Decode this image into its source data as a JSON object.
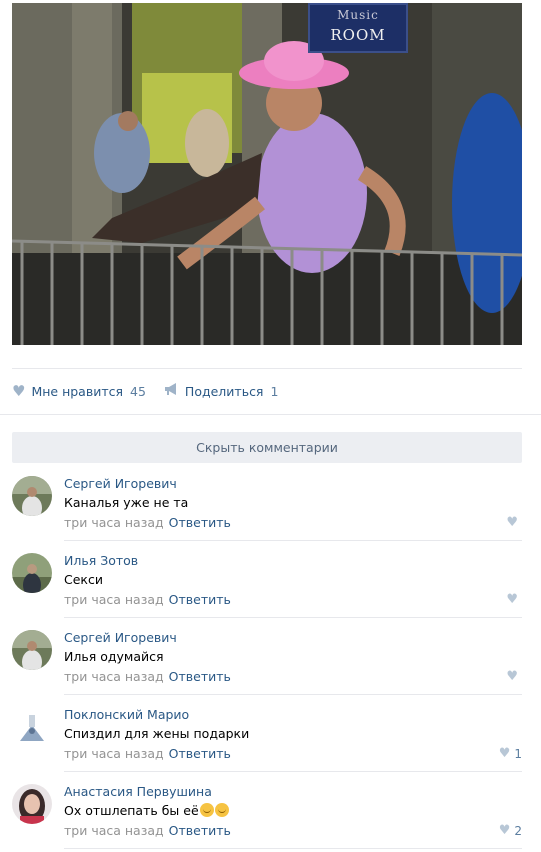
{
  "photo": {
    "sign_line1": "Music",
    "sign_line2": "ROOM"
  },
  "actions": {
    "like_label": "Мне нравится",
    "like_count": "45",
    "share_label": "Поделиться",
    "share_count": "1"
  },
  "hide_comments_label": "Скрыть комментарии",
  "comments": [
    {
      "author": "Сергей Игоревич",
      "text": "Каналья уже не та",
      "time": "три часа назад",
      "reply": "Ответить",
      "likes": ""
    },
    {
      "author": "Илья Зотов",
      "text": "Секси",
      "time": "три часа назад",
      "reply": "Ответить",
      "likes": ""
    },
    {
      "author": "Сергей Игоревич",
      "text": "Илья одумайся",
      "time": "три часа назад",
      "reply": "Ответить",
      "likes": ""
    },
    {
      "author": "Поклонский Марио",
      "text": "Спиздил для жены подарки",
      "time": "три часа назад",
      "reply": "Ответить",
      "likes": "1"
    },
    {
      "author": "Анастасия Первушина",
      "text": "Ох отшлепать бы её",
      "time": "три часа назад",
      "reply": "Ответить",
      "likes": "2"
    }
  ],
  "colors": {
    "link": "#2a5885",
    "meta": "#939393",
    "button_bg": "#eceef2",
    "divider": "#e7e8ec"
  },
  "icons": {
    "like": "heart-icon",
    "share": "megaphone-icon",
    "comment_like": "heart-icon",
    "emoji": "smile-emoji-icon"
  }
}
